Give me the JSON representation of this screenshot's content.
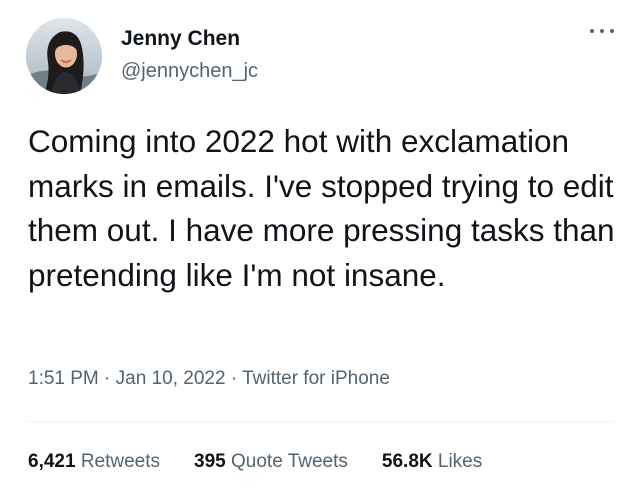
{
  "author": {
    "display_name": "Jenny Chen",
    "handle": "@jennychen_jc",
    "avatar_icon": "profile-photo"
  },
  "more_icon": "more-horizontal-icon",
  "tweet": {
    "text": "Coming into 2022 hot with exclamation marks in emails. I've stopped trying to edit them out. I have more pressing tasks than pretending like I'm not insane.",
    "time": "1:51 PM",
    "separator": "·",
    "date": "Jan 10, 2022",
    "source": "Twitter for iPhone"
  },
  "stats": {
    "retweets_count": "6,421",
    "retweets_label": "Retweets",
    "quotes_count": "395",
    "quotes_label": "Quote Tweets",
    "likes_count": "56.8K",
    "likes_label": "Likes"
  },
  "colors": {
    "primary_text": "#0f1419",
    "secondary_text": "#536471",
    "divider": "#eff3f4",
    "background": "#ffffff"
  }
}
